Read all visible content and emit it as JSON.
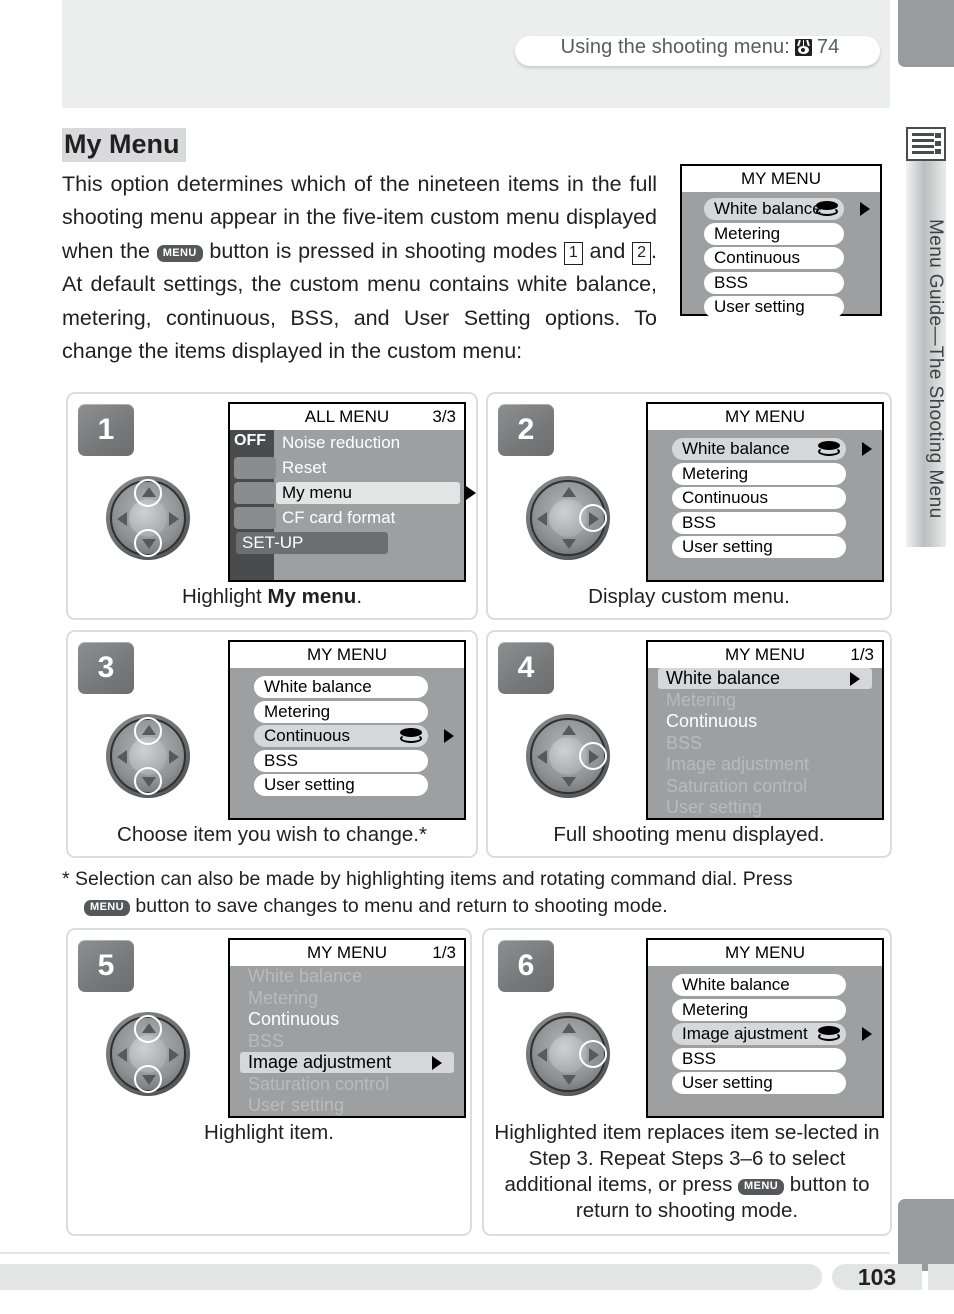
{
  "header": {
    "text": "Using the shooting menu:",
    "page_ref": "74",
    "icon": "eye-icon"
  },
  "side_tab": {
    "label": "Menu Guide—The Shooting Menu",
    "icon": "menu-list-icon"
  },
  "title": "My Menu",
  "intro": {
    "p1": "This option determines which of the nineteen items in the full shooting menu appear in the five-item custom menu displayed when the",
    "menu_button": "MENU",
    "p2": "button is pressed in shooting modes",
    "mode1": "1",
    "and": "and",
    "mode2": "2",
    "p3": ".  At default settings, the custom menu contains white balance, metering, continuous, BSS, and User Setting options.  To change the items displayed in the custom menu:"
  },
  "hero_screen": {
    "title": "MY MENU",
    "items": [
      {
        "label": "White balance",
        "state": "selected",
        "wb_icon": true,
        "arrow": true
      },
      {
        "label": "Metering",
        "state": "white"
      },
      {
        "label": "Continuous",
        "state": "white"
      },
      {
        "label": "BSS",
        "state": "white"
      },
      {
        "label": "User setting",
        "state": "white"
      }
    ]
  },
  "steps": [
    {
      "number": "1",
      "caption_plain": "Highlight ",
      "caption_bold": "My menu",
      "caption_tail": ".",
      "selector_highlights": [
        "up",
        "down"
      ],
      "screen": {
        "title": "ALL MENU",
        "page": "3/3",
        "style": "allmenu",
        "badge": "OFF",
        "items": [
          {
            "label": "Noise reduction",
            "state": "dim"
          },
          {
            "label": "Reset",
            "state": "dim"
          },
          {
            "label": "My menu",
            "state": "sel",
            "arrow": true
          },
          {
            "label": "CF card format",
            "state": "dim"
          },
          {
            "label": "SET-UP",
            "state": "setup"
          }
        ]
      }
    },
    {
      "number": "2",
      "caption_plain": "Display custom menu.",
      "selector_highlights": [
        "right"
      ],
      "screen": {
        "title": "MY MENU",
        "page": "",
        "style": "mymenu",
        "items": [
          {
            "label": "White balance",
            "state": "sel",
            "wb_icon": true,
            "arrow": true
          },
          {
            "label": "Metering",
            "state": "white"
          },
          {
            "label": "Continuous",
            "state": "white"
          },
          {
            "label": "BSS",
            "state": "white"
          },
          {
            "label": "User setting",
            "state": "white"
          }
        ]
      }
    },
    {
      "number": "3",
      "caption_plain": "Choose item you wish to change.*",
      "selector_highlights": [
        "up",
        "down"
      ],
      "screen": {
        "title": "MY MENU",
        "page": "",
        "style": "mymenu",
        "items": [
          {
            "label": "White balance",
            "state": "white"
          },
          {
            "label": "Metering",
            "state": "white"
          },
          {
            "label": "Continuous",
            "state": "sel",
            "wb_icon": true,
            "arrow": true
          },
          {
            "label": "BSS",
            "state": "white"
          },
          {
            "label": "User setting",
            "state": "white"
          }
        ]
      }
    },
    {
      "number": "4",
      "caption_plain": "Full shooting menu displayed.",
      "selector_highlights": [
        "right"
      ],
      "screen": {
        "title": "MY MENU",
        "page": "1/3",
        "style": "fullmenu",
        "items": [
          {
            "label": "White balance",
            "state": "sel",
            "arrow": true
          },
          {
            "label": "Metering",
            "state": "dim"
          },
          {
            "label": "Continuous",
            "state": "bright"
          },
          {
            "label": "BSS",
            "state": "dim"
          },
          {
            "label": "Image adjustment",
            "state": "dim"
          },
          {
            "label": "Saturation control",
            "state": "dim"
          },
          {
            "label": "User setting",
            "state": "dim"
          }
        ]
      }
    },
    {
      "number": "5",
      "caption_plain": "Highlight item.",
      "selector_highlights": [
        "up",
        "down"
      ],
      "screen": {
        "title": "MY MENU",
        "page": "1/3",
        "style": "fullmenu",
        "items": [
          {
            "label": "White balance",
            "state": "dim"
          },
          {
            "label": "Metering",
            "state": "dim"
          },
          {
            "label": "Continuous",
            "state": "bright"
          },
          {
            "label": "BSS",
            "state": "dim"
          },
          {
            "label": "Image adjustment",
            "state": "sel",
            "arrow": true
          },
          {
            "label": "Saturation control",
            "state": "dim"
          },
          {
            "label": "User setting",
            "state": "dim"
          }
        ]
      }
    },
    {
      "number": "6",
      "caption_plain": "Highlighted item replaces item se-lected in Step 3.  Repeat Steps 3–6 to select additional items, or press ",
      "caption_menu_button": "MENU",
      "caption_tail2": " button to return to shooting mode.",
      "selector_highlights": [
        "right"
      ],
      "screen": {
        "title": "MY MENU",
        "page": "",
        "style": "mymenu",
        "items": [
          {
            "label": "White balance",
            "state": "white"
          },
          {
            "label": "Metering",
            "state": "white"
          },
          {
            "label": "Image ajustment",
            "state": "sel",
            "wb_icon": true,
            "arrow": true
          },
          {
            "label": "BSS",
            "state": "white"
          },
          {
            "label": "User setting",
            "state": "white"
          }
        ]
      }
    }
  ],
  "footnote": {
    "line1": "* Selection can also be made by highlighting items and rotating command dial.  Press",
    "menu_button": "MENU",
    "line2": " button to save changes to menu and return to shooting mode."
  },
  "page_number": "103"
}
